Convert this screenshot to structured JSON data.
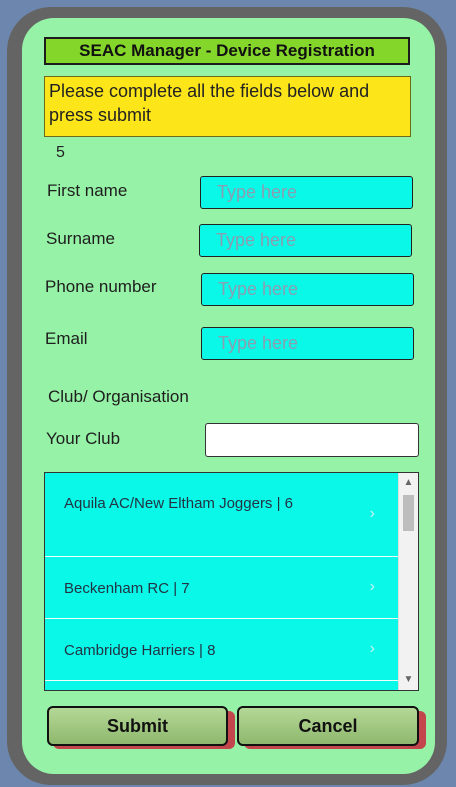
{
  "app": {
    "title": "SEAC Manager - Device Registration",
    "notice": "Please complete all the fields below and press submit",
    "count": "5"
  },
  "fields": {
    "first_name": {
      "label": "First name",
      "placeholder": "Type here"
    },
    "surname": {
      "label": "Surname",
      "placeholder": "Type here"
    },
    "phone": {
      "label": "Phone number",
      "placeholder": "Type here"
    },
    "email": {
      "label": "Email",
      "placeholder": "Type here"
    }
  },
  "club": {
    "section_label": "Club/ Organisation",
    "your_club_label": "Your Club",
    "your_club_value": "",
    "items": [
      {
        "label": "Aquila AC/New Eltham Joggers  |  6"
      },
      {
        "label": "Beckenham RC  |  7"
      },
      {
        "label": "Cambridge Harriers  |  8"
      }
    ]
  },
  "actions": {
    "submit_label": "Submit",
    "cancel_label": "Cancel"
  },
  "colors": {
    "background": "#96f2a6",
    "title_bg": "#84d62b",
    "notice_bg": "#fce61a",
    "input_bg": "#0af8e8",
    "button_shadow": "#c3464d"
  }
}
